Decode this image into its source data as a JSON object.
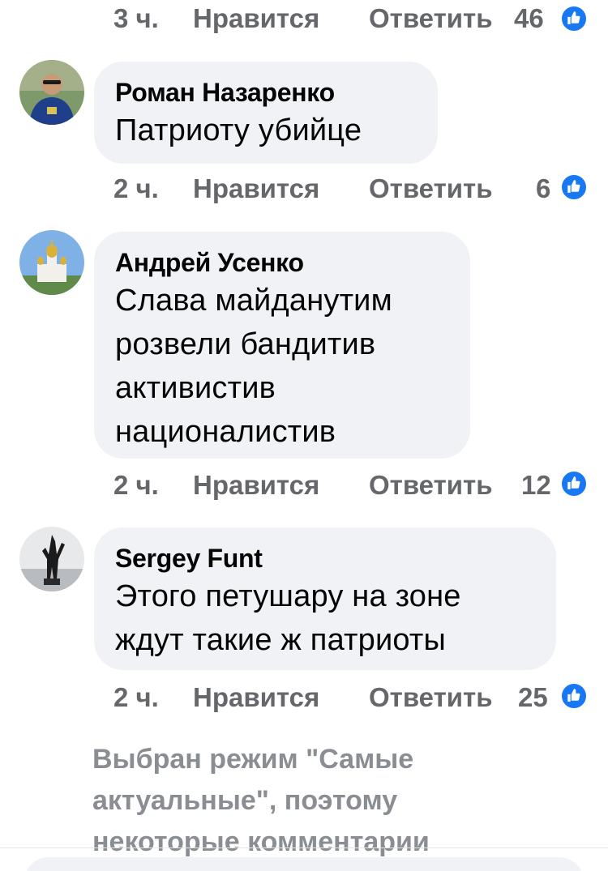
{
  "top_actions": {
    "time": "3 ч.",
    "like_label": "Нравится",
    "reply_label": "Ответить",
    "reactions": "46"
  },
  "comments": [
    {
      "author": "Роман Назаренко",
      "text_lines": [
        "Патриоту убийце"
      ],
      "time": "2 ч.",
      "like_label": "Нравится",
      "reply_label": "Ответить",
      "reactions": "6"
    },
    {
      "author": "Андрей Усенко",
      "text_lines": [
        "Слава майданутим",
        "розвели бандитив",
        "активистив",
        "националистив"
      ],
      "time": "2 ч.",
      "like_label": "Нравится",
      "reply_label": "Ответить",
      "reactions": "12"
    },
    {
      "author": "Sergey Funt",
      "text_lines": [
        "Этого петушару на зоне",
        "ждут такие ж патриоты"
      ],
      "time": "2 ч.",
      "like_label": "Нравится",
      "reply_label": "Ответить",
      "reactions": "25"
    }
  ],
  "notice_lines": [
    "Выбран режим \"Самые",
    "актуальные\", поэтому",
    "некоторые комментарии"
  ],
  "colors": {
    "bubble": "#f0f2f5",
    "meta_text": "#65676b",
    "like_blue": "#1877f2",
    "notice_text": "#8a8d91"
  },
  "icons": {
    "like": "thumbs-up-icon"
  }
}
